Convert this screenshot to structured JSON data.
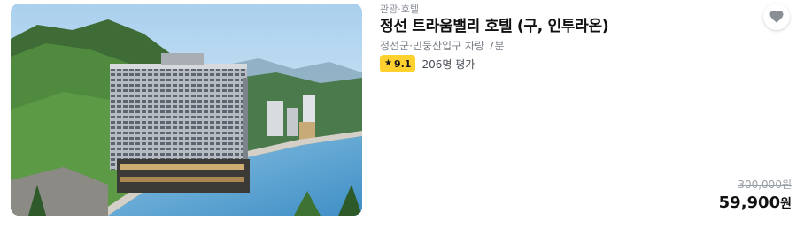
{
  "listing": {
    "category": "관광·호텔",
    "name": "정선 트라움밸리 호텔 (구, 인투라온)",
    "location": "정선군·민둥산입구 차량 7분",
    "rating": {
      "score": "9.1",
      "icon": "star-icon",
      "reviews": "206명 평가",
      "badge_color": "#ffd12e"
    },
    "wishlist": {
      "icon": "heart-icon"
    },
    "price": {
      "original": "300,000원",
      "final_amount": "59,900",
      "final_unit": "원"
    }
  }
}
